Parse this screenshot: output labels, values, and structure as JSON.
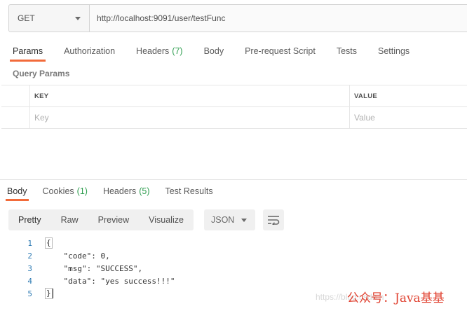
{
  "request": {
    "method": "GET",
    "url": "http://localhost:9091/user/testFunc"
  },
  "request_tabs": [
    {
      "label": "Params",
      "count": "",
      "active": true
    },
    {
      "label": "Authorization",
      "count": ""
    },
    {
      "label": "Headers",
      "count": "(7)"
    },
    {
      "label": "Body",
      "count": ""
    },
    {
      "label": "Pre-request Script",
      "count": ""
    },
    {
      "label": "Tests",
      "count": ""
    },
    {
      "label": "Settings",
      "count": ""
    }
  ],
  "query_params": {
    "title": "Query Params",
    "header_key": "KEY",
    "header_value": "VALUE",
    "placeholder_key": "Key",
    "placeholder_value": "Value"
  },
  "response_tabs": [
    {
      "label": "Body",
      "count": "",
      "active": true
    },
    {
      "label": "Cookies",
      "count": "(1)"
    },
    {
      "label": "Headers",
      "count": "(5)"
    },
    {
      "label": "Test Results",
      "count": ""
    }
  ],
  "format_buttons": [
    "Pretty",
    "Raw",
    "Preview",
    "Visualize"
  ],
  "language": "JSON",
  "code_lines": {
    "l1": {
      "num": "1",
      "text": "{"
    },
    "l2": {
      "num": "2",
      "key": "\"code\"",
      "sep": ": ",
      "val": "0",
      "tail": ","
    },
    "l3": {
      "num": "3",
      "key": "\"msg\"",
      "sep": ": ",
      "val": "\"SUCCESS\"",
      "tail": ","
    },
    "l4": {
      "num": "4",
      "key": "\"data\"",
      "sep": ": ",
      "val": "\"yes success!!!\"",
      "tail": ""
    },
    "l5": {
      "num": "5",
      "text": "}"
    }
  },
  "watermark": {
    "faint": "https://blog.csdn.n",
    "text": "公众号：Java基基"
  },
  "colors": {
    "accent": "#f26b3a",
    "count_green": "#2f9e50",
    "line_number_blue": "#2d7ab3",
    "watermark_red": "#e0402f"
  }
}
